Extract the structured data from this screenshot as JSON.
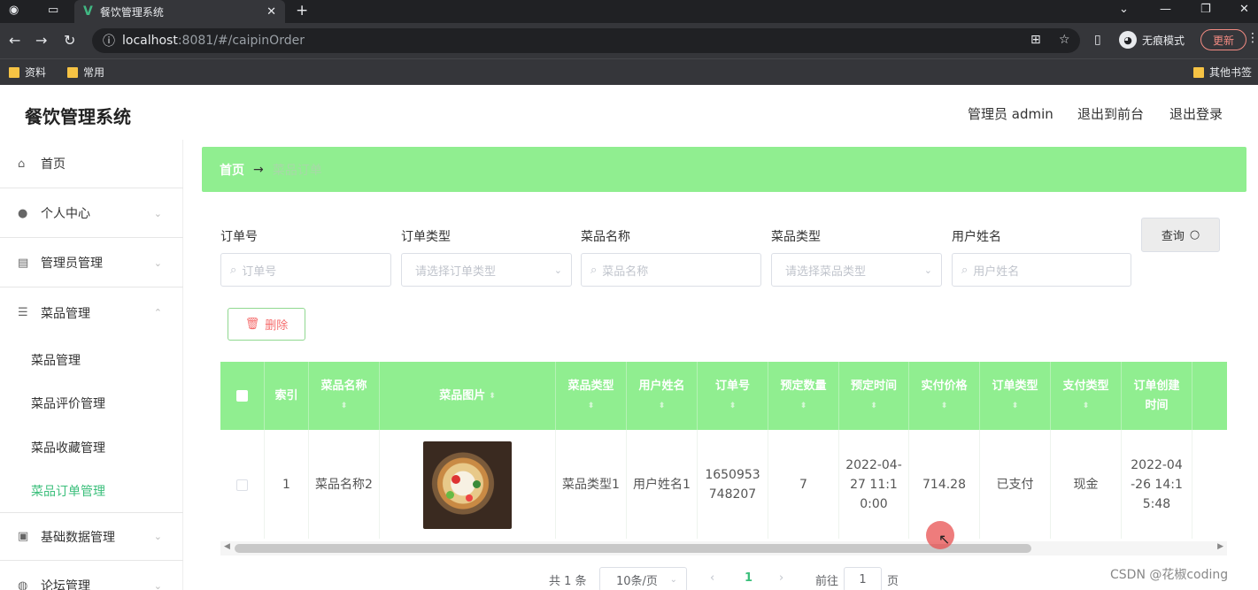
{
  "browser": {
    "tab_title": "餐饮管理系统",
    "tab_close": "✕",
    "new_tab": "+",
    "url_host": "localhost",
    "url_path": ":8081/#/caipinOrder",
    "incognito_label": "无痕模式",
    "update_label": "更新",
    "bookmarks": [
      "资料",
      "常用"
    ],
    "other_bookmarks": "其他书签"
  },
  "header": {
    "brand": "餐饮管理系统",
    "admin": "管理员 admin",
    "to_front": "退出到前台",
    "logout": "退出登录"
  },
  "sidebar": {
    "items": [
      {
        "label": "首页",
        "icon": "home-icon"
      },
      {
        "label": "个人中心",
        "icon": "user-icon"
      },
      {
        "label": "管理员管理",
        "icon": "list-icon"
      },
      {
        "label": "菜品管理",
        "icon": "sliders-icon"
      },
      {
        "label": "基础数据管理",
        "icon": "clipboard-icon"
      },
      {
        "label": "论坛管理",
        "icon": "forum-icon"
      }
    ],
    "subitems": [
      "菜品管理",
      "菜品评价管理",
      "菜品收藏管理",
      "菜品订单管理"
    ]
  },
  "breadcrumb": {
    "home": "首页",
    "arrow": "→",
    "current": "菜品订单"
  },
  "filters": {
    "order_no_label": "订单号",
    "order_no_placeholder": "订单号",
    "order_type_label": "订单类型",
    "order_type_placeholder": "请选择订单类型",
    "dish_name_label": "菜品名称",
    "dish_name_placeholder": "菜品名称",
    "dish_type_label": "菜品类型",
    "dish_type_placeholder": "请选择菜品类型",
    "user_name_label": "用户姓名",
    "user_name_placeholder": "用户姓名",
    "search_button": "查询"
  },
  "actions": {
    "delete_button": "删除"
  },
  "table": {
    "headers": [
      "索引",
      "菜品名称",
      "菜品图片",
      "菜品类型",
      "用户姓名",
      "订单号",
      "预定数量",
      "预定时间",
      "实付价格",
      "订单类型",
      "支付类型",
      "订单创建时间"
    ],
    "rows": [
      {
        "index": "1",
        "dish_name": "菜品名称2",
        "dish_type": "菜品类型1",
        "user_name": "用户姓名1",
        "order_no": "1650953748207",
        "quantity": "7",
        "reserve_time": "2022-04-27 11:10:00",
        "paid_price": "714.28",
        "order_type": "已支付",
        "pay_type": "现金",
        "created_time": "2022-04-26 14:15:48"
      }
    ]
  },
  "pagination": {
    "total": "共 1 条",
    "page_size": "10条/页",
    "prev": "‹",
    "current_page": "1",
    "next": "›",
    "goto": "前往",
    "goto_value": "1",
    "page_unit": "页"
  },
  "watermark": "CSDN @花椒coding"
}
